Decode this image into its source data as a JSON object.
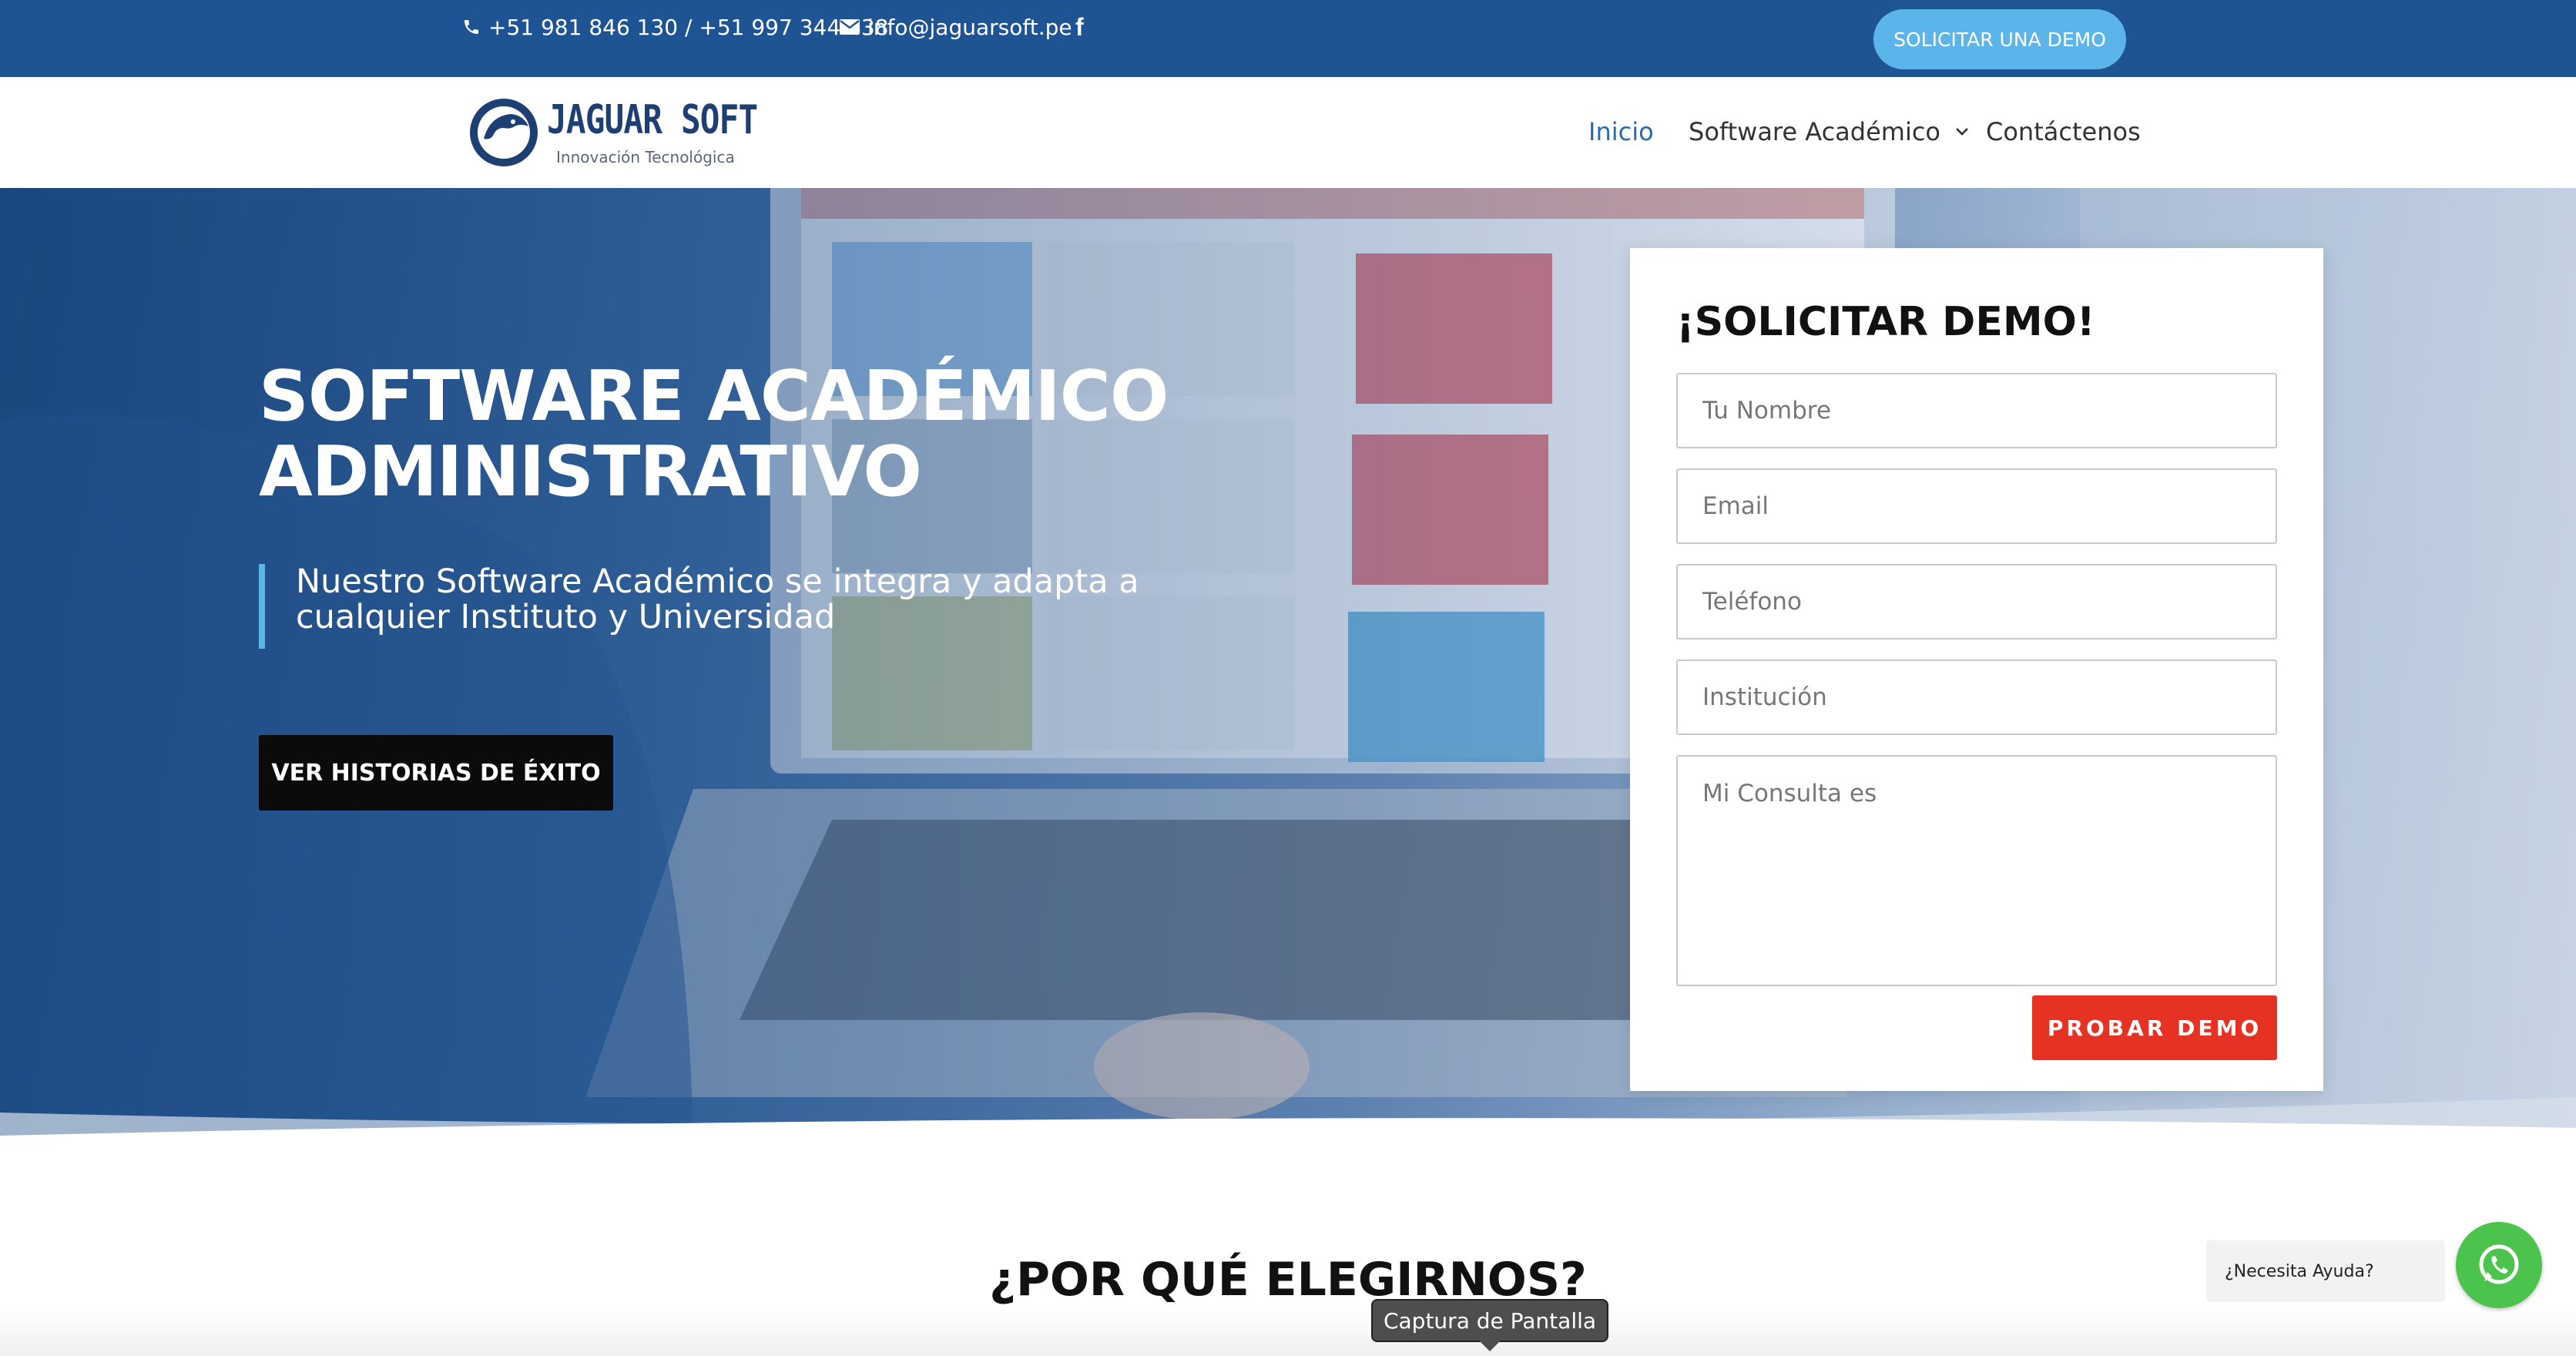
{
  "topbar": {
    "phone": "+51 981 846 130 / +51 997 344 438",
    "email": "info@jaguarsoft.pe",
    "facebook_icon": "f",
    "demo_button": "SOLICITAR UNA DEMO",
    "icons": [
      "phone-icon",
      "envelope-icon",
      "facebook-icon"
    ]
  },
  "header": {
    "logo_title": "JAGUAR SOFT",
    "logo_sub": "Innovación Tecnológica",
    "nav": {
      "inicio": "Inicio",
      "software": "Software Académico",
      "contact": "Contáctenos"
    },
    "active_color": "#2a6bb0"
  },
  "hero": {
    "title": "SOFTWARE ACADÉMICO ADMINISTRATIVO",
    "subtitle": "Nuestro Software Académico se integra y adapta a cualquier Instituto y Universidad",
    "cta": "VER HISTORIAS DE ÉXITO"
  },
  "form": {
    "title": "¡SOLICITAR DEMO!",
    "name_placeholder": "Tu Nombre",
    "email_placeholder": "Email",
    "phone_placeholder": "Teléfono",
    "institution_placeholder": "Institución",
    "query_placeholder": "Mi Consulta es",
    "submit": "PROBAR DEMO",
    "submit_color": "#e53222"
  },
  "why": {
    "title": "¿POR QUÉ ELEGIRNOS?"
  },
  "chat": {
    "help_text": "¿Necesita Ayuda?",
    "icon": "whatsapp-icon",
    "color": "#4bc34d"
  },
  "tooltip": {
    "text": "Captura de Pantalla"
  },
  "brand_color": "#1f5494"
}
